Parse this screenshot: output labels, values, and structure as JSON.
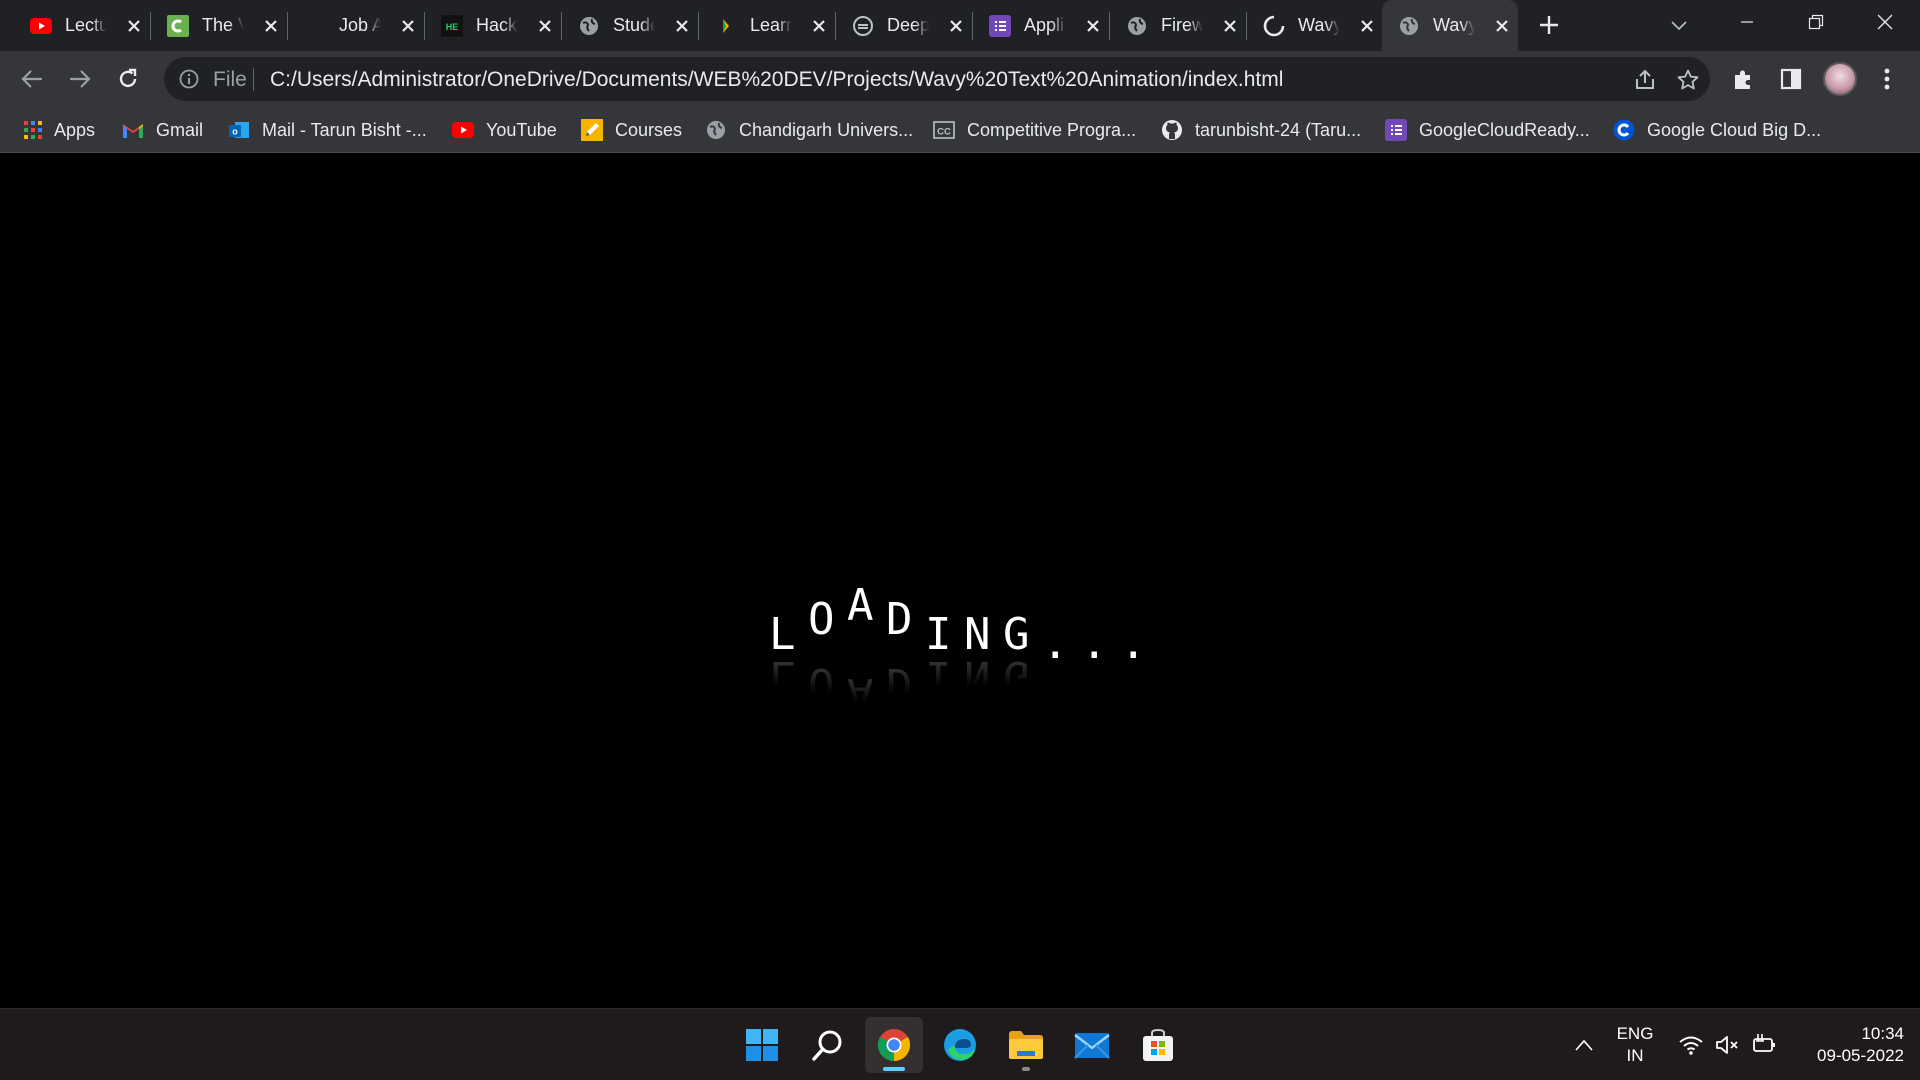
{
  "browser": {
    "tabs": [
      {
        "title": "Lectu",
        "icon": "youtube-icon",
        "active": false
      },
      {
        "title": "The V",
        "icon": "codechef-icon",
        "active": false
      },
      {
        "title": "Job A",
        "icon": "blank-icon",
        "active": false
      },
      {
        "title": "Hack",
        "icon": "hackerearth-icon",
        "active": false
      },
      {
        "title": "Stude",
        "icon": "globe-icon",
        "active": false
      },
      {
        "title": "Learn",
        "icon": "flag-icon",
        "active": false
      },
      {
        "title": "Deep",
        "icon": "deepai-icon",
        "active": false
      },
      {
        "title": "Appli",
        "icon": "list-icon",
        "active": false
      },
      {
        "title": "Firew",
        "icon": "globe-icon",
        "active": false
      },
      {
        "title": "Wavy",
        "icon": "loading-icon",
        "active": false
      },
      {
        "title": "Wavy",
        "icon": "globe-icon",
        "active": true
      }
    ],
    "omnibox": {
      "scheme": "File",
      "url": "C:/Users/Administrator/OneDrive/Documents/WEB%20DEV/Projects/Wavy%20Text%20Animation/index.html"
    },
    "bookmarks": [
      {
        "label": "Apps",
        "icon": "apps-grid-icon"
      },
      {
        "label": "Gmail",
        "icon": "gmail-icon"
      },
      {
        "label": "Mail - Tarun Bisht -...",
        "icon": "outlook-icon"
      },
      {
        "label": "YouTube",
        "icon": "youtube-icon"
      },
      {
        "label": "Courses",
        "icon": "pencil-icon"
      },
      {
        "label": "Chandigarh Univers...",
        "icon": "globe-icon"
      },
      {
        "label": "Competitive Progra...",
        "icon": "cc-icon"
      },
      {
        "label": "tarunbisht-24 (Taru...",
        "icon": "github-icon"
      },
      {
        "label": "GoogleCloudReady...",
        "icon": "list-icon"
      },
      {
        "label": "Google Cloud Big D...",
        "icon": "coursera-icon"
      }
    ]
  },
  "page": {
    "letters": [
      "L",
      "O",
      "A",
      "D",
      "I",
      "N",
      "G",
      ".",
      ".",
      "."
    ]
  },
  "taskbar": {
    "apps": [
      {
        "name": "start",
        "icon": "windows-start-icon"
      },
      {
        "name": "search",
        "icon": "search-icon"
      },
      {
        "name": "chrome",
        "icon": "chrome-icon",
        "active": true
      },
      {
        "name": "edge",
        "icon": "edge-icon"
      },
      {
        "name": "explorer",
        "icon": "folder-icon",
        "running": true
      },
      {
        "name": "mail",
        "icon": "mail-icon"
      },
      {
        "name": "store",
        "icon": "store-icon"
      }
    ],
    "language": {
      "line1": "ENG",
      "line2": "IN"
    },
    "clock": {
      "time": "10:34",
      "date": "09-05-2022"
    }
  },
  "colors": {
    "tab_strip": "#202124",
    "toolbar": "#35363a",
    "page_bg": "#000000",
    "taskbar": "#1f1b1d",
    "accent": "#60cdff"
  }
}
